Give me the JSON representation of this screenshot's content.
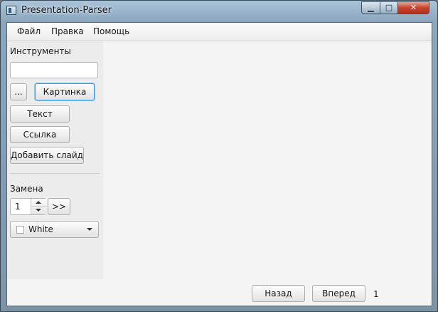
{
  "window": {
    "title": "Presentation-Parser"
  },
  "menu": {
    "items": [
      "Файл",
      "Правка",
      "Помощь"
    ]
  },
  "sidebar": {
    "tools_label": "Инструменты",
    "path_input_value": "",
    "browse_label": "...",
    "image_label": "Картинка",
    "text_label": "Текст",
    "link_label": "Ссылка",
    "add_slide_label": "Добавить слайд",
    "replace_label": "Замена",
    "spinner_value": "1",
    "go_label": ">>",
    "color_select": {
      "value": "White",
      "checked": false
    }
  },
  "nav": {
    "back_label": "Назад",
    "forward_label": "Вперед",
    "page": "1"
  },
  "icons": {
    "app": "app-window-icon",
    "minimize": "minimize-icon",
    "maximize": "maximize-icon",
    "close": "close-icon"
  },
  "colors": {
    "focus_accent": "#3d9ad8",
    "close_button": "#c6432a"
  }
}
